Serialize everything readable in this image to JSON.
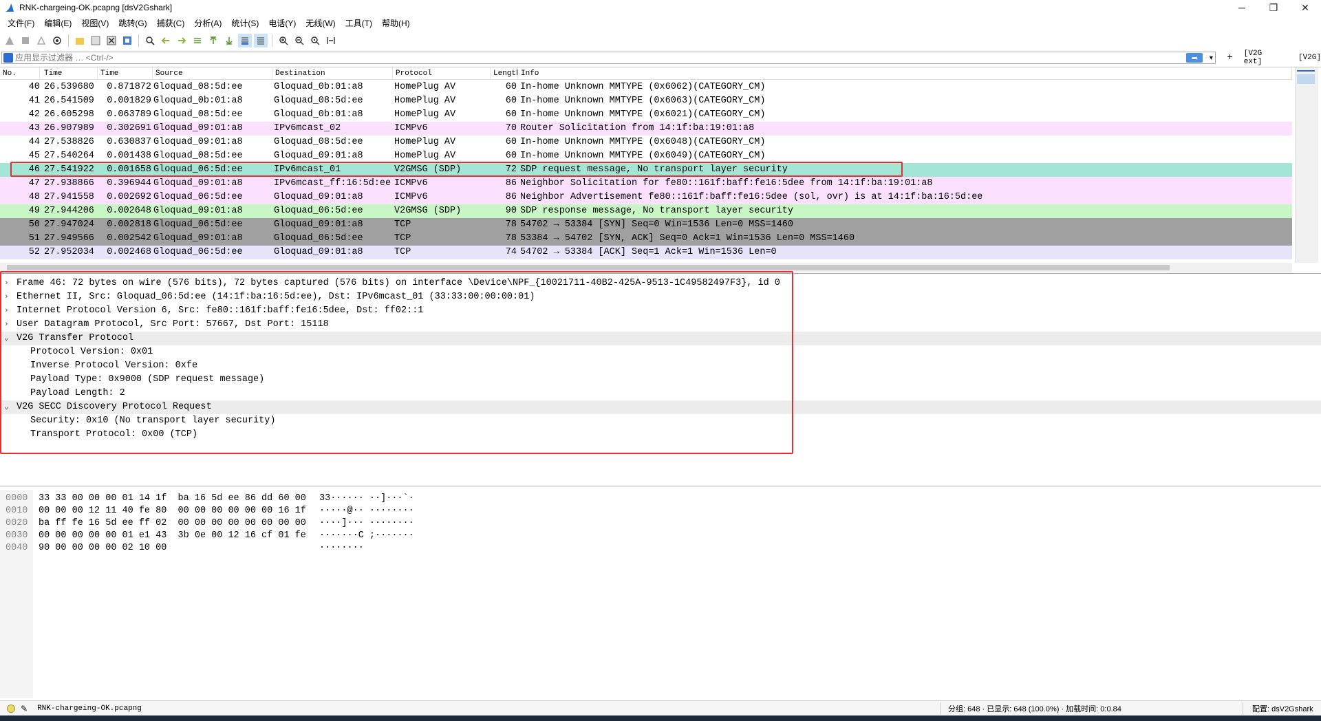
{
  "window": {
    "title": "RNK-chargeing-OK.pcapng [dsV2Gshark]",
    "minimize": "─",
    "restore": "❐",
    "close": "✕"
  },
  "menu": [
    "文件(F)",
    "编辑(E)",
    "视图(V)",
    "跳转(G)",
    "捕获(C)",
    "分析(A)",
    "统计(S)",
    "电话(Y)",
    "无线(W)",
    "工具(T)",
    "帮助(H)"
  ],
  "filter": {
    "placeholder": "应用显示过滤器 … <Ctrl-/>",
    "apply_icon": "arrow-right-icon",
    "plus": "+",
    "button1": "[V2G ext]",
    "button2": "[V2G]"
  },
  "columns": [
    "No.",
    "Time",
    "Time (delta)",
    "Source",
    "Destination",
    "Protocol",
    "Length",
    "Info"
  ],
  "packets": [
    {
      "no": "40",
      "time": "26.539680",
      "delta": "0.871872",
      "src": "Gloquad_08:5d:ee",
      "dst": "Gloquad_0b:01:a8",
      "proto": "HomePlug AV",
      "len": "60",
      "info": "In-home Unknown MMTYPE (0x6062)(CATEGORY_CM)",
      "bg": "#ffffff"
    },
    {
      "no": "41",
      "time": "26.541509",
      "delta": "0.001829",
      "src": "Gloquad_0b:01:a8",
      "dst": "Gloquad_08:5d:ee",
      "proto": "HomePlug AV",
      "len": "60",
      "info": "In-home Unknown MMTYPE (0x6063)(CATEGORY_CM)",
      "bg": "#ffffff"
    },
    {
      "no": "42",
      "time": "26.605298",
      "delta": "0.063789",
      "src": "Gloquad_08:5d:ee",
      "dst": "Gloquad_0b:01:a8",
      "proto": "HomePlug AV",
      "len": "60",
      "info": "In-home Unknown MMTYPE (0x6021)(CATEGORY_CM)",
      "bg": "#ffffff"
    },
    {
      "no": "43",
      "time": "26.907989",
      "delta": "0.302691",
      "src": "Gloquad_09:01:a8",
      "dst": "IPv6mcast_02",
      "proto": "ICMPv6",
      "len": "70",
      "info": "Router Solicitation from 14:1f:ba:19:01:a8",
      "bg": "#fce0ff"
    },
    {
      "no": "44",
      "time": "27.538826",
      "delta": "0.630837",
      "src": "Gloquad_09:01:a8",
      "dst": "Gloquad_08:5d:ee",
      "proto": "HomePlug AV",
      "len": "60",
      "info": "In-home Unknown MMTYPE (0x6048)(CATEGORY_CM)",
      "bg": "#ffffff"
    },
    {
      "no": "45",
      "time": "27.540264",
      "delta": "0.001438",
      "src": "Gloquad_08:5d:ee",
      "dst": "Gloquad_09:01:a8",
      "proto": "HomePlug AV",
      "len": "60",
      "info": "In-home Unknown MMTYPE (0x6049)(CATEGORY_CM)",
      "bg": "#ffffff"
    },
    {
      "no": "46",
      "time": "27.541922",
      "delta": "0.001658",
      "src": "Gloquad_06:5d:ee",
      "dst": "IPv6mcast_01",
      "proto": "V2GMSG (SDP)",
      "len": "72",
      "info": "SDP request message, No transport layer security",
      "bg": "#a4e6d6"
    },
    {
      "no": "47",
      "time": "27.938866",
      "delta": "0.396944",
      "src": "Gloquad_09:01:a8",
      "dst": "IPv6mcast_ff:16:5d:ee",
      "proto": "ICMPv6",
      "len": "86",
      "info": "Neighbor Solicitation for fe80::161f:baff:fe16:5dee from 14:1f:ba:19:01:a8",
      "bg": "#fce0ff"
    },
    {
      "no": "48",
      "time": "27.941558",
      "delta": "0.002692",
      "src": "Gloquad_06:5d:ee",
      "dst": "Gloquad_09:01:a8",
      "proto": "ICMPv6",
      "len": "86",
      "info": "Neighbor Advertisement fe80::161f:baff:fe16:5dee (sol, ovr) is at 14:1f:ba:16:5d:ee",
      "bg": "#fce0ff"
    },
    {
      "no": "49",
      "time": "27.944206",
      "delta": "0.002648",
      "src": "Gloquad_09:01:a8",
      "dst": "Gloquad_06:5d:ee",
      "proto": "V2GMSG (SDP)",
      "len": "90",
      "info": "SDP response message, No transport layer security",
      "bg": "#c8f7c5"
    },
    {
      "no": "50",
      "time": "27.947024",
      "delta": "0.002818",
      "src": "Gloquad_06:5d:ee",
      "dst": "Gloquad_09:01:a8",
      "proto": "TCP",
      "len": "78",
      "info": "54702 → 53384 [SYN] Seq=0 Win=1536 Len=0 MSS=1460",
      "bg": "#a0a0a0"
    },
    {
      "no": "51",
      "time": "27.949566",
      "delta": "0.002542",
      "src": "Gloquad_09:01:a8",
      "dst": "Gloquad_06:5d:ee",
      "proto": "TCP",
      "len": "78",
      "info": "53384 → 54702 [SYN, ACK] Seq=0 Ack=1 Win=1536 Len=0 MSS=1460",
      "bg": "#a0a0a0"
    },
    {
      "no": "52",
      "time": "27.952034",
      "delta": "0.002468",
      "src": "Gloquad_06:5d:ee",
      "dst": "Gloquad_09:01:a8",
      "proto": "TCP",
      "len": "74",
      "info": "54702 → 53384 [ACK] Seq=1 Ack=1 Win=1536 Len=0",
      "bg": "#e4e4fa"
    }
  ],
  "details": [
    {
      "arrow": "›",
      "text": "Frame 46: 72 bytes on wire (576 bits), 72 bytes captured (576 bits) on interface \\Device\\NPF_{10021711-40B2-425A-9513-1C49582497F3}, id 0",
      "child": false,
      "section": false
    },
    {
      "arrow": "›",
      "text": "Ethernet II, Src: Gloquad_06:5d:ee (14:1f:ba:16:5d:ee), Dst: IPv6mcast_01 (33:33:00:00:00:01)",
      "child": false,
      "section": false
    },
    {
      "arrow": "›",
      "text": "Internet Protocol Version 6, Src: fe80::161f:baff:fe16:5dee, Dst: ff02::1",
      "child": false,
      "section": false
    },
    {
      "arrow": "›",
      "text": "User Datagram Protocol, Src Port: 57667, Dst Port: 15118",
      "child": false,
      "section": false
    },
    {
      "arrow": "⌄",
      "text": "V2G Transfer Protocol",
      "child": false,
      "section": true
    },
    {
      "arrow": "",
      "text": "Protocol Version: 0x01",
      "child": true,
      "section": false
    },
    {
      "arrow": "",
      "text": "Inverse Protocol Version: 0xfe",
      "child": true,
      "section": false
    },
    {
      "arrow": "",
      "text": "Payload Type: 0x9000 (SDP request message)",
      "child": true,
      "section": false
    },
    {
      "arrow": "",
      "text": "Payload Length: 2",
      "child": true,
      "section": false
    },
    {
      "arrow": "⌄",
      "text": "V2G SECC Discovery Protocol Request",
      "child": false,
      "section": true
    },
    {
      "arrow": "",
      "text": "Security: 0x10 (No transport layer security)",
      "child": true,
      "section": false
    },
    {
      "arrow": "",
      "text": "Transport Protocol: 0x00 (TCP)",
      "child": true,
      "section": false
    }
  ],
  "hex": [
    {
      "off": "0000",
      "bytes": "33 33 00 00 00 01 14 1f  ba 16 5d ee 86 dd 60 00",
      "ascii": "33······ ··]···`·"
    },
    {
      "off": "0010",
      "bytes": "00 00 00 12 11 40 fe 80  00 00 00 00 00 00 16 1f",
      "ascii": "·····@·· ········"
    },
    {
      "off": "0020",
      "bytes": "ba ff fe 16 5d ee ff 02  00 00 00 00 00 00 00 00",
      "ascii": "····]··· ········"
    },
    {
      "off": "0030",
      "bytes": "00 00 00 00 00 01 e1 43  3b 0e 00 12 16 cf 01 fe",
      "ascii": "·······C ;·······"
    },
    {
      "off": "0040",
      "bytes": "90 00 00 00 00 02 10 00",
      "ascii": "········"
    }
  ],
  "status": {
    "file": "RNK-chargeing-OK.pcapng",
    "stats": "分组: 648 · 已显示: 648 (100.0%) · 加载时间: 0:0.84",
    "profile": "配置: dsV2Gshark"
  },
  "colors": {
    "highlight_box": "#e03030"
  }
}
